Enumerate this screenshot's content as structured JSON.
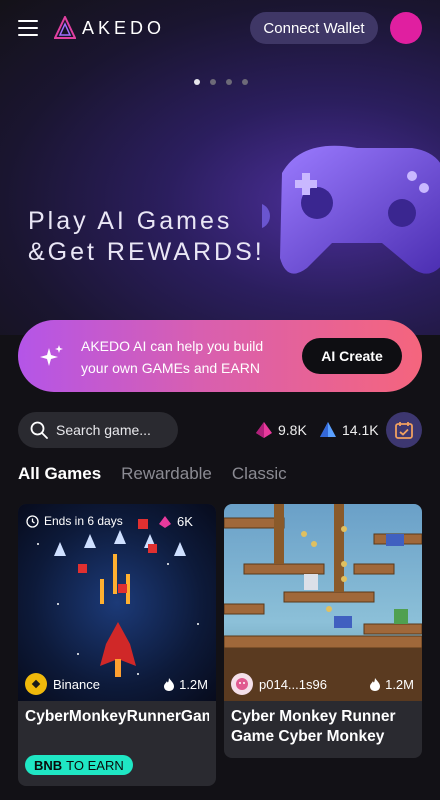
{
  "header": {
    "brand": "AKEDO",
    "connect_label": "Connect Wallet"
  },
  "hero": {
    "line1": "Play AI Games",
    "line2": "&Get REWARDS!",
    "slides": 4,
    "active_slide": 1
  },
  "ai_banner": {
    "text": "AKEDO AI can help you build your own GAMEs and EARN",
    "button_label": "AI Create"
  },
  "search": {
    "placeholder": "Search game..."
  },
  "stats": {
    "stat1": "9.8K",
    "stat2": "14.1K"
  },
  "tabs": [
    {
      "label": "All Games",
      "active": true
    },
    {
      "label": "Rewardable",
      "active": false
    },
    {
      "label": "Classic",
      "active": false
    }
  ],
  "cards": [
    {
      "ends": "Ends in 6 days",
      "top_stat": "6K",
      "owner": "Binance",
      "plays": "1.2M",
      "title": "CyberMonkeyRunnerGameCybeMonkeyMon...",
      "earn_token": "BNB",
      "earn_text": "TO EARN"
    },
    {
      "owner": "p014...1s96",
      "plays": "1.2M",
      "title": "Cyber Monkey Runner Game Cyber Monkey"
    }
  ],
  "colors": {
    "accent": "#3f3766",
    "avatar": "#e01fa0",
    "earn_badge": "#1fe6c4",
    "banner_start": "#b455e8",
    "banner_end": "#f5657d"
  }
}
